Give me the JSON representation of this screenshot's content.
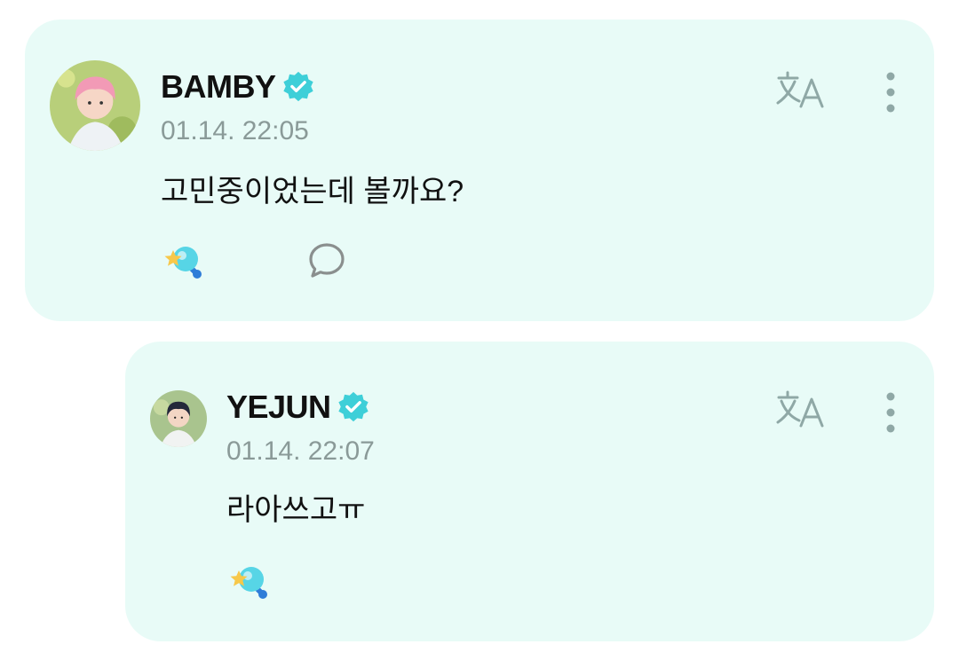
{
  "posts": [
    {
      "author": "BAMBY",
      "verified": true,
      "timestamp": "01.14. 22:05",
      "content": "고민중이었는데 볼까요?",
      "cheer_count": "",
      "comment_count": "",
      "icons": [
        "avatar",
        "verified-badge-icon",
        "translate-icon",
        "more-options-icon",
        "cheer-lightstick-icon",
        "comment-icon"
      ]
    },
    {
      "author": "YEJUN",
      "verified": true,
      "timestamp": "01.14. 22:07",
      "content": "라아쓰고ㅠ",
      "cheer_count": "",
      "icons": [
        "avatar",
        "verified-badge-icon",
        "translate-icon",
        "more-options-icon",
        "cheer-lightstick-icon"
      ]
    }
  ],
  "colors": {
    "card_background": "#e8fbf7",
    "verified_badge": "#3ecfd8",
    "timestamp": "#8a9a98",
    "icon_gray": "#8fa8a6"
  }
}
